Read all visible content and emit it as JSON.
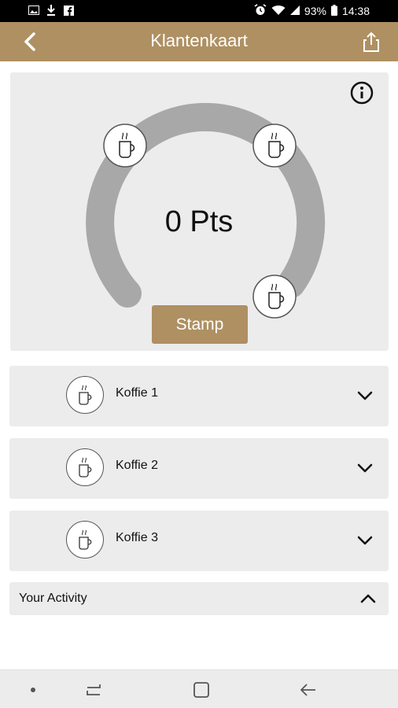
{
  "status": {
    "battery": "93%",
    "time": "14:38"
  },
  "header": {
    "title": "Klantenkaart",
    "back_icon": "chevron-left-icon",
    "share_icon": "share-icon"
  },
  "card": {
    "points_label": "0 Pts",
    "points": 0,
    "stamp_label": "Stamp"
  },
  "rewards": [
    {
      "label": "Koffie 1"
    },
    {
      "label": "Koffie 2"
    },
    {
      "label": "Koffie 3"
    }
  ],
  "activity": {
    "label": "Your Activity"
  },
  "colors": {
    "accent": "#ae9062",
    "card_bg": "#ececec",
    "ring": "#a8a8a8"
  }
}
